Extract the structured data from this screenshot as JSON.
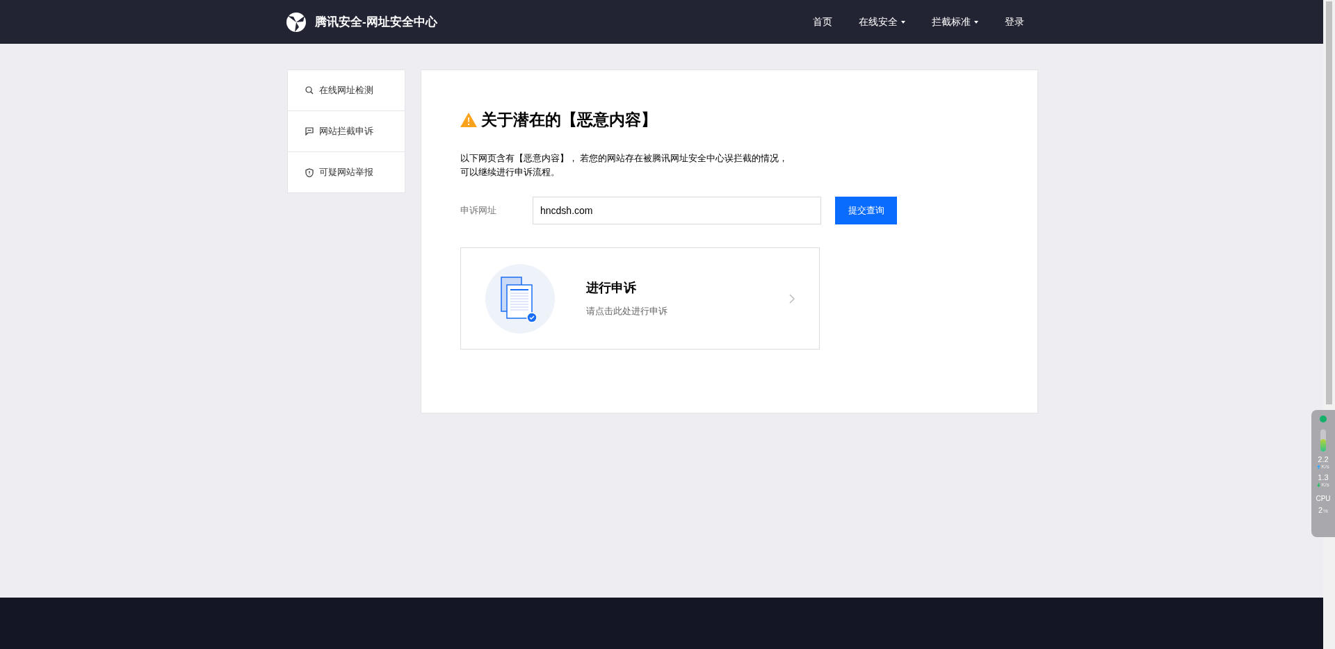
{
  "header": {
    "logo_text": "腾讯安全-网址安全中心",
    "nav": [
      {
        "label": "首页",
        "dropdown": false
      },
      {
        "label": "在线安全",
        "dropdown": true
      },
      {
        "label": "拦截标准",
        "dropdown": true
      },
      {
        "label": "登录",
        "dropdown": false
      }
    ]
  },
  "sidebar": {
    "items": [
      {
        "label": "在线网址检测",
        "kind": "search"
      },
      {
        "label": "网站拦截申诉",
        "kind": "message"
      },
      {
        "label": "可疑网站举报",
        "kind": "shield"
      }
    ]
  },
  "notice": {
    "title": "关于潜在的【恶意内容】",
    "description_lines": [
      "以下网页含有【恶意内容】， 若您的网站存在被腾讯网址安全中心误拦截的情况，",
      "可以继续进行申诉流程。"
    ]
  },
  "form": {
    "label": "申诉网址",
    "value": "hncdsh.com",
    "button": "提交查询"
  },
  "appeal_card": {
    "title": "进行申诉",
    "subtitle": "请点击此处进行申诉"
  },
  "monitor": {
    "memory": {
      "level": 0.55
    },
    "upload": "2.2",
    "upload_unit": "K/s",
    "download": "1.3",
    "download_unit": "K/s",
    "cpu_label": "CPU",
    "cpu_value": "2",
    "cpu_unit": "%"
  }
}
